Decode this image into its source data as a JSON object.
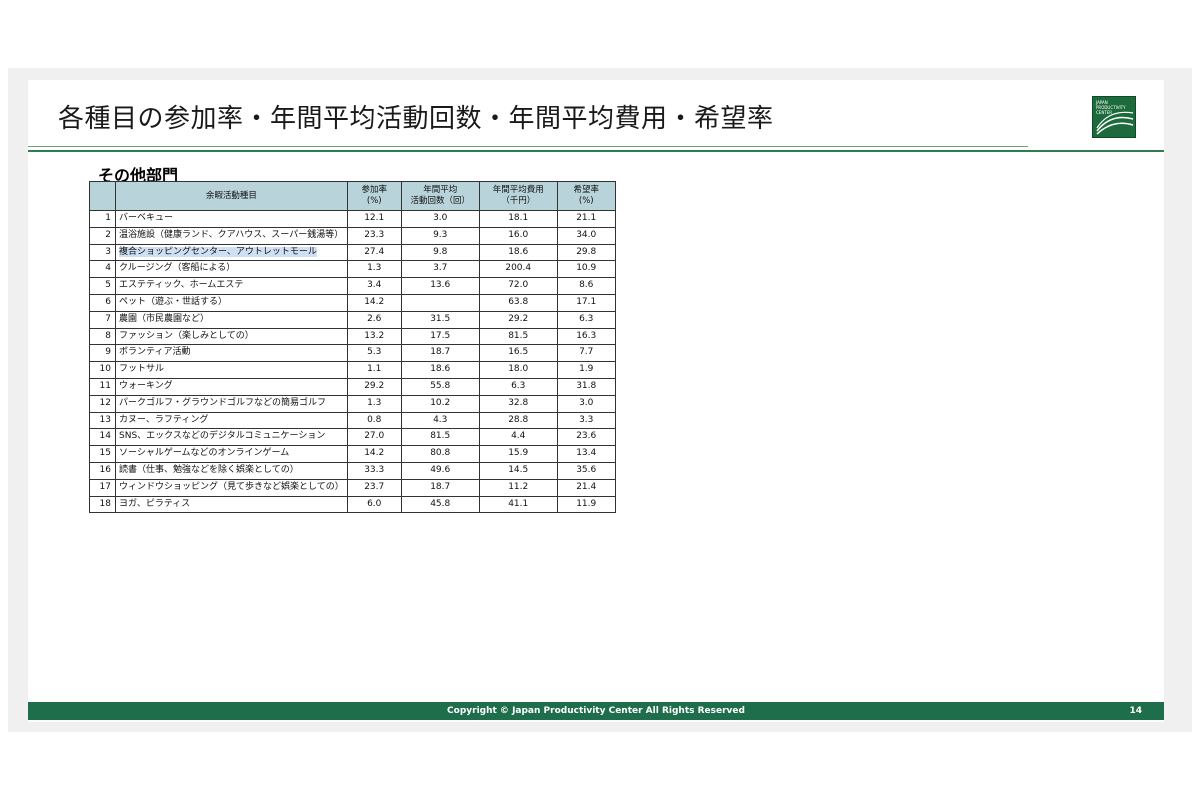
{
  "slide": {
    "title": "各種目の参加率・年間平均活動回数・年間平均費用・希望率",
    "section_title": "その他部門",
    "logo_text": "JAPAN PRODUCTIVITY CENTER",
    "footer": "Copyright © Japan Productivity Center All Rights Reserved",
    "page_number": "14",
    "colors": {
      "footer": "#1e6e4c",
      "header_fill": "#b8d4da",
      "rule": "#2e7d4f"
    }
  },
  "table": {
    "headers": {
      "activity": "余暇活動種目",
      "participation_l1": "参加率",
      "participation_l2": "(%)",
      "frequency_l1": "年間平均",
      "frequency_l2": "活動回数（回）",
      "cost_l1": "年間平均費用",
      "cost_l2": "（千円）",
      "desire_l1": "希望率",
      "desire_l2": "(%)"
    },
    "rows": [
      {
        "no": "1",
        "name": "バーベキュー",
        "rate": "12.1",
        "freq": "3.0",
        "cost": "18.1",
        "hope": "21.1"
      },
      {
        "no": "2",
        "name": "温浴施設（健康ランド、クアハウス、スーパー銭湯等）",
        "rate": "23.3",
        "freq": "9.3",
        "cost": "16.0",
        "hope": "34.0"
      },
      {
        "no": "3",
        "name": "複合ショッピングセンター、アウトレットモール",
        "rate": "27.4",
        "freq": "9.8",
        "cost": "18.6",
        "hope": "29.8"
      },
      {
        "no": "4",
        "name": "クルージング（客船による）",
        "rate": "1.3",
        "freq": "3.7",
        "cost": "200.4",
        "hope": "10.9"
      },
      {
        "no": "5",
        "name": "エステティック、ホームエステ",
        "rate": "3.4",
        "freq": "13.6",
        "cost": "72.0",
        "hope": "8.6"
      },
      {
        "no": "6",
        "name": "ペット（遊ぶ・世話する）",
        "rate": "14.2",
        "freq": "",
        "cost": "63.8",
        "hope": "17.1"
      },
      {
        "no": "7",
        "name": "農園（市民農園など）",
        "rate": "2.6",
        "freq": "31.5",
        "cost": "29.2",
        "hope": "6.3"
      },
      {
        "no": "8",
        "name": "ファッション（楽しみとしての）",
        "rate": "13.2",
        "freq": "17.5",
        "cost": "81.5",
        "hope": "16.3"
      },
      {
        "no": "9",
        "name": "ボランティア活動",
        "rate": "5.3",
        "freq": "18.7",
        "cost": "16.5",
        "hope": "7.7"
      },
      {
        "no": "10",
        "name": "フットサル",
        "rate": "1.1",
        "freq": "18.6",
        "cost": "18.0",
        "hope": "1.9"
      },
      {
        "no": "11",
        "name": "ウォーキング",
        "rate": "29.2",
        "freq": "55.8",
        "cost": "6.3",
        "hope": "31.8"
      },
      {
        "no": "12",
        "name": "パークゴルフ・グラウンドゴルフなどの簡易ゴルフ",
        "rate": "1.3",
        "freq": "10.2",
        "cost": "32.8",
        "hope": "3.0"
      },
      {
        "no": "13",
        "name": "カヌー、ラフティング",
        "rate": "0.8",
        "freq": "4.3",
        "cost": "28.8",
        "hope": "3.3"
      },
      {
        "no": "14",
        "name": "SNS、エックスなどのデジタルコミュニケーション",
        "rate": "27.0",
        "freq": "81.5",
        "cost": "4.4",
        "hope": "23.6"
      },
      {
        "no": "15",
        "name": "ソーシャルゲームなどのオンラインゲーム",
        "rate": "14.2",
        "freq": "80.8",
        "cost": "15.9",
        "hope": "13.4"
      },
      {
        "no": "16",
        "name": "読書（仕事、勉強などを除く娯楽としての）",
        "rate": "33.3",
        "freq": "49.6",
        "cost": "14.5",
        "hope": "35.6"
      },
      {
        "no": "17",
        "name": "ウィンドウショッピング（見て歩きなど娯楽としての）",
        "rate": "23.7",
        "freq": "18.7",
        "cost": "11.2",
        "hope": "21.4"
      },
      {
        "no": "18",
        "name": "ヨガ、ピラティス",
        "rate": "6.0",
        "freq": "45.8",
        "cost": "41.1",
        "hope": "11.9"
      }
    ]
  }
}
